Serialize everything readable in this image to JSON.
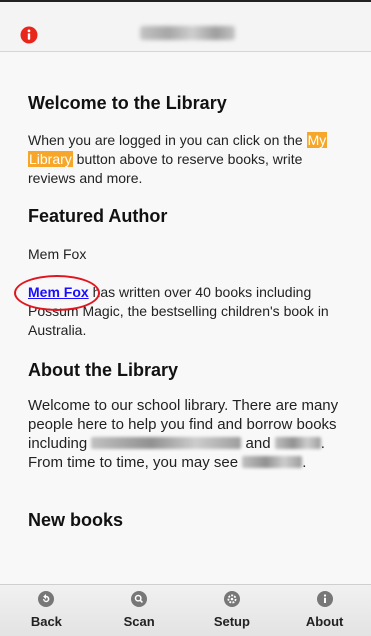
{
  "header": {
    "info_icon": "info-icon"
  },
  "welcome": {
    "heading": "Welcome to the Library",
    "text_before": "When you are logged in you can click on the ",
    "highlight_1": "My",
    "highlight_2": "Library",
    "text_after": " button above to reserve books, write reviews and more."
  },
  "featured": {
    "heading": "Featured Author",
    "author_name": "Mem Fox",
    "author_link": "Mem Fox",
    "author_desc": " has written over 40 books including Possum Magic, the bestselling children's book in Australia."
  },
  "about": {
    "heading": "About the Library",
    "text_1": "Welcome to our school library. There are many people here to help you find and borrow books including ",
    "text_2": " and ",
    "text_3": ". From time to time, you may see ",
    "text_4": "."
  },
  "new_books": {
    "heading": "New books"
  },
  "toolbar": {
    "buttons": [
      {
        "label": "Back",
        "icon": "back-arrow-icon"
      },
      {
        "label": "Scan",
        "icon": "search-icon"
      },
      {
        "label": "Setup",
        "icon": "gear-icon"
      },
      {
        "label": "About",
        "icon": "info-icon"
      }
    ]
  },
  "colors": {
    "highlight": "#f6a72a",
    "link": "#1a0dff",
    "annotation_circle": "#e0151f",
    "info_icon": "#e8261c"
  }
}
